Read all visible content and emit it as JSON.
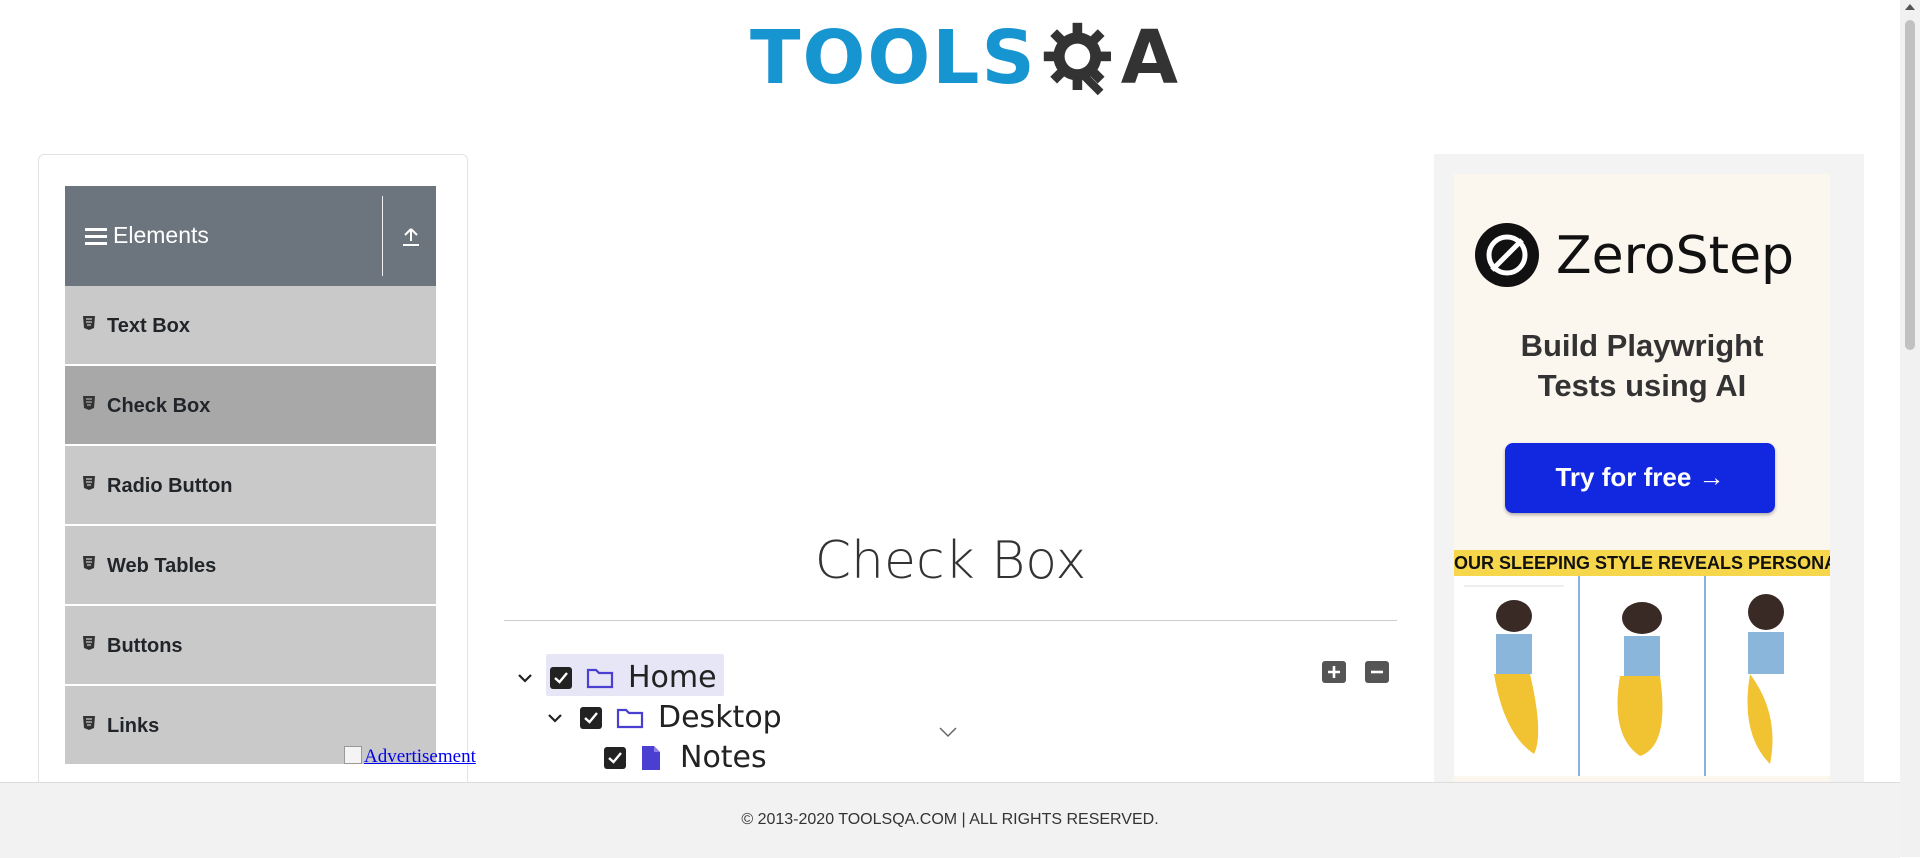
{
  "header": {
    "logo_tools": "TOOLS",
    "logo_qa": "A"
  },
  "sidebar": {
    "group_title": "Elements",
    "items": [
      {
        "label": "Text Box",
        "active": false
      },
      {
        "label": "Check Box",
        "active": true
      },
      {
        "label": "Radio Button",
        "active": false
      },
      {
        "label": "Web Tables",
        "active": false
      },
      {
        "label": "Buttons",
        "active": false
      },
      {
        "label": "Links",
        "active": false
      }
    ]
  },
  "ad_link": "Advertisement",
  "main": {
    "title": "Check Box",
    "tree": [
      {
        "label": "Home",
        "checked": true,
        "expanded": true,
        "icon": "folder-icon"
      },
      {
        "label": "Desktop",
        "checked": true,
        "expanded": true,
        "icon": "folder-icon"
      },
      {
        "label": "Notes",
        "checked": true,
        "icon": "file-icon"
      }
    ],
    "expand_all_icon": "plus-icon",
    "collapse_all_icon": "minus-icon"
  },
  "ad": {
    "brand": "ZeroStep",
    "tagline_line1": "Build Playwright",
    "tagline_line2": "Tests using AI",
    "cta": "Try for free →",
    "banner": "OUR SLEEPING STYLE REVEALS PERSONALIT"
  },
  "footer": {
    "text": "© 2013-2020 TOOLSQA.COM | ALL RIGHTS RESERVED."
  },
  "colors": {
    "sidebar_header": "#6c757d",
    "menu_item": "#c9c9c9",
    "menu_active": "#a8a8a8",
    "logo_blue": "#1795d0",
    "cta_blue": "#1228e0",
    "home_highlight": "#e7e6f7"
  }
}
